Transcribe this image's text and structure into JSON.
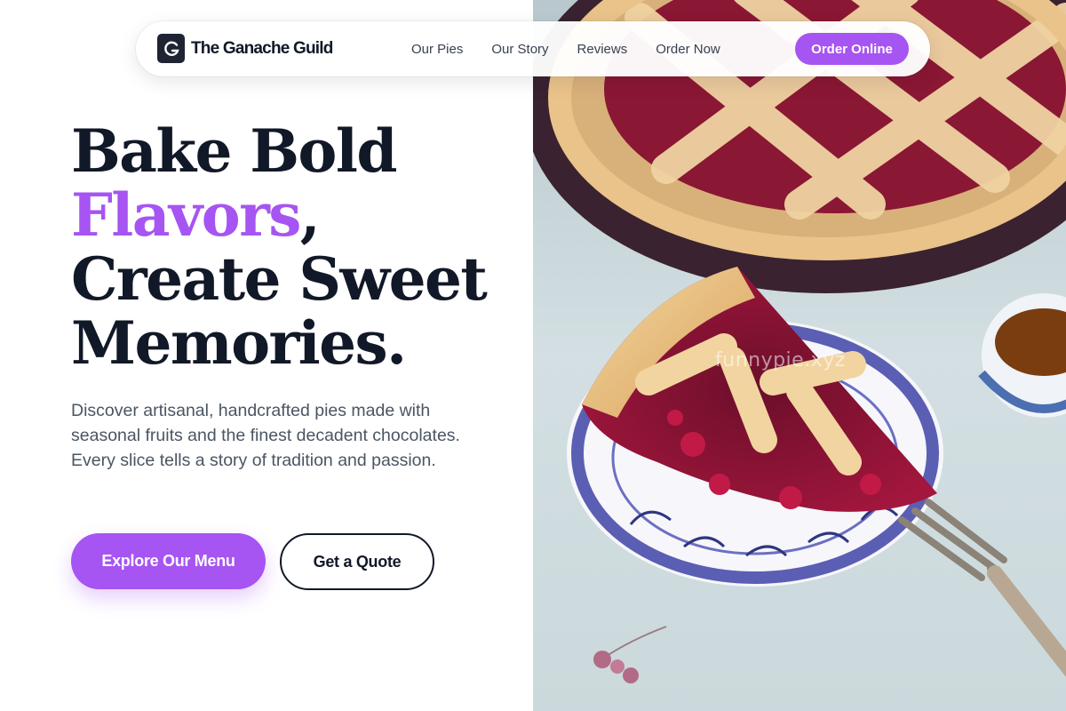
{
  "nav": {
    "brand_initial": "G",
    "brand_name": "The Ganache Guild",
    "links": [
      "Our Pies",
      "Our Story",
      "Reviews",
      "Order Now"
    ],
    "cta_label": "Order Online"
  },
  "hero": {
    "headline_line1": "Bake Bold",
    "headline_accent": "Flavors",
    "headline_comma": ",",
    "headline_line3": "Create Sweet",
    "headline_line4": "Memories.",
    "description": "Discover artisanal, handcrafted pies made with seasonal fruits and the finest decadent chocolates. Every slice tells a story of tradition and passion.",
    "primary_button": "Explore Our Menu",
    "secondary_button": "Get a Quote"
  },
  "photo": {
    "subject": "cherry lattice pie slice on a blue-patterned plate with fork and tea cup",
    "watermark": "funnypie.xyz"
  },
  "colors": {
    "accent": "#a654f2",
    "text_dark": "#111827",
    "text_muted": "#4b5563",
    "brand_mark": "#1f2433"
  },
  "icons": {
    "brand": "brand-logo-icon"
  }
}
